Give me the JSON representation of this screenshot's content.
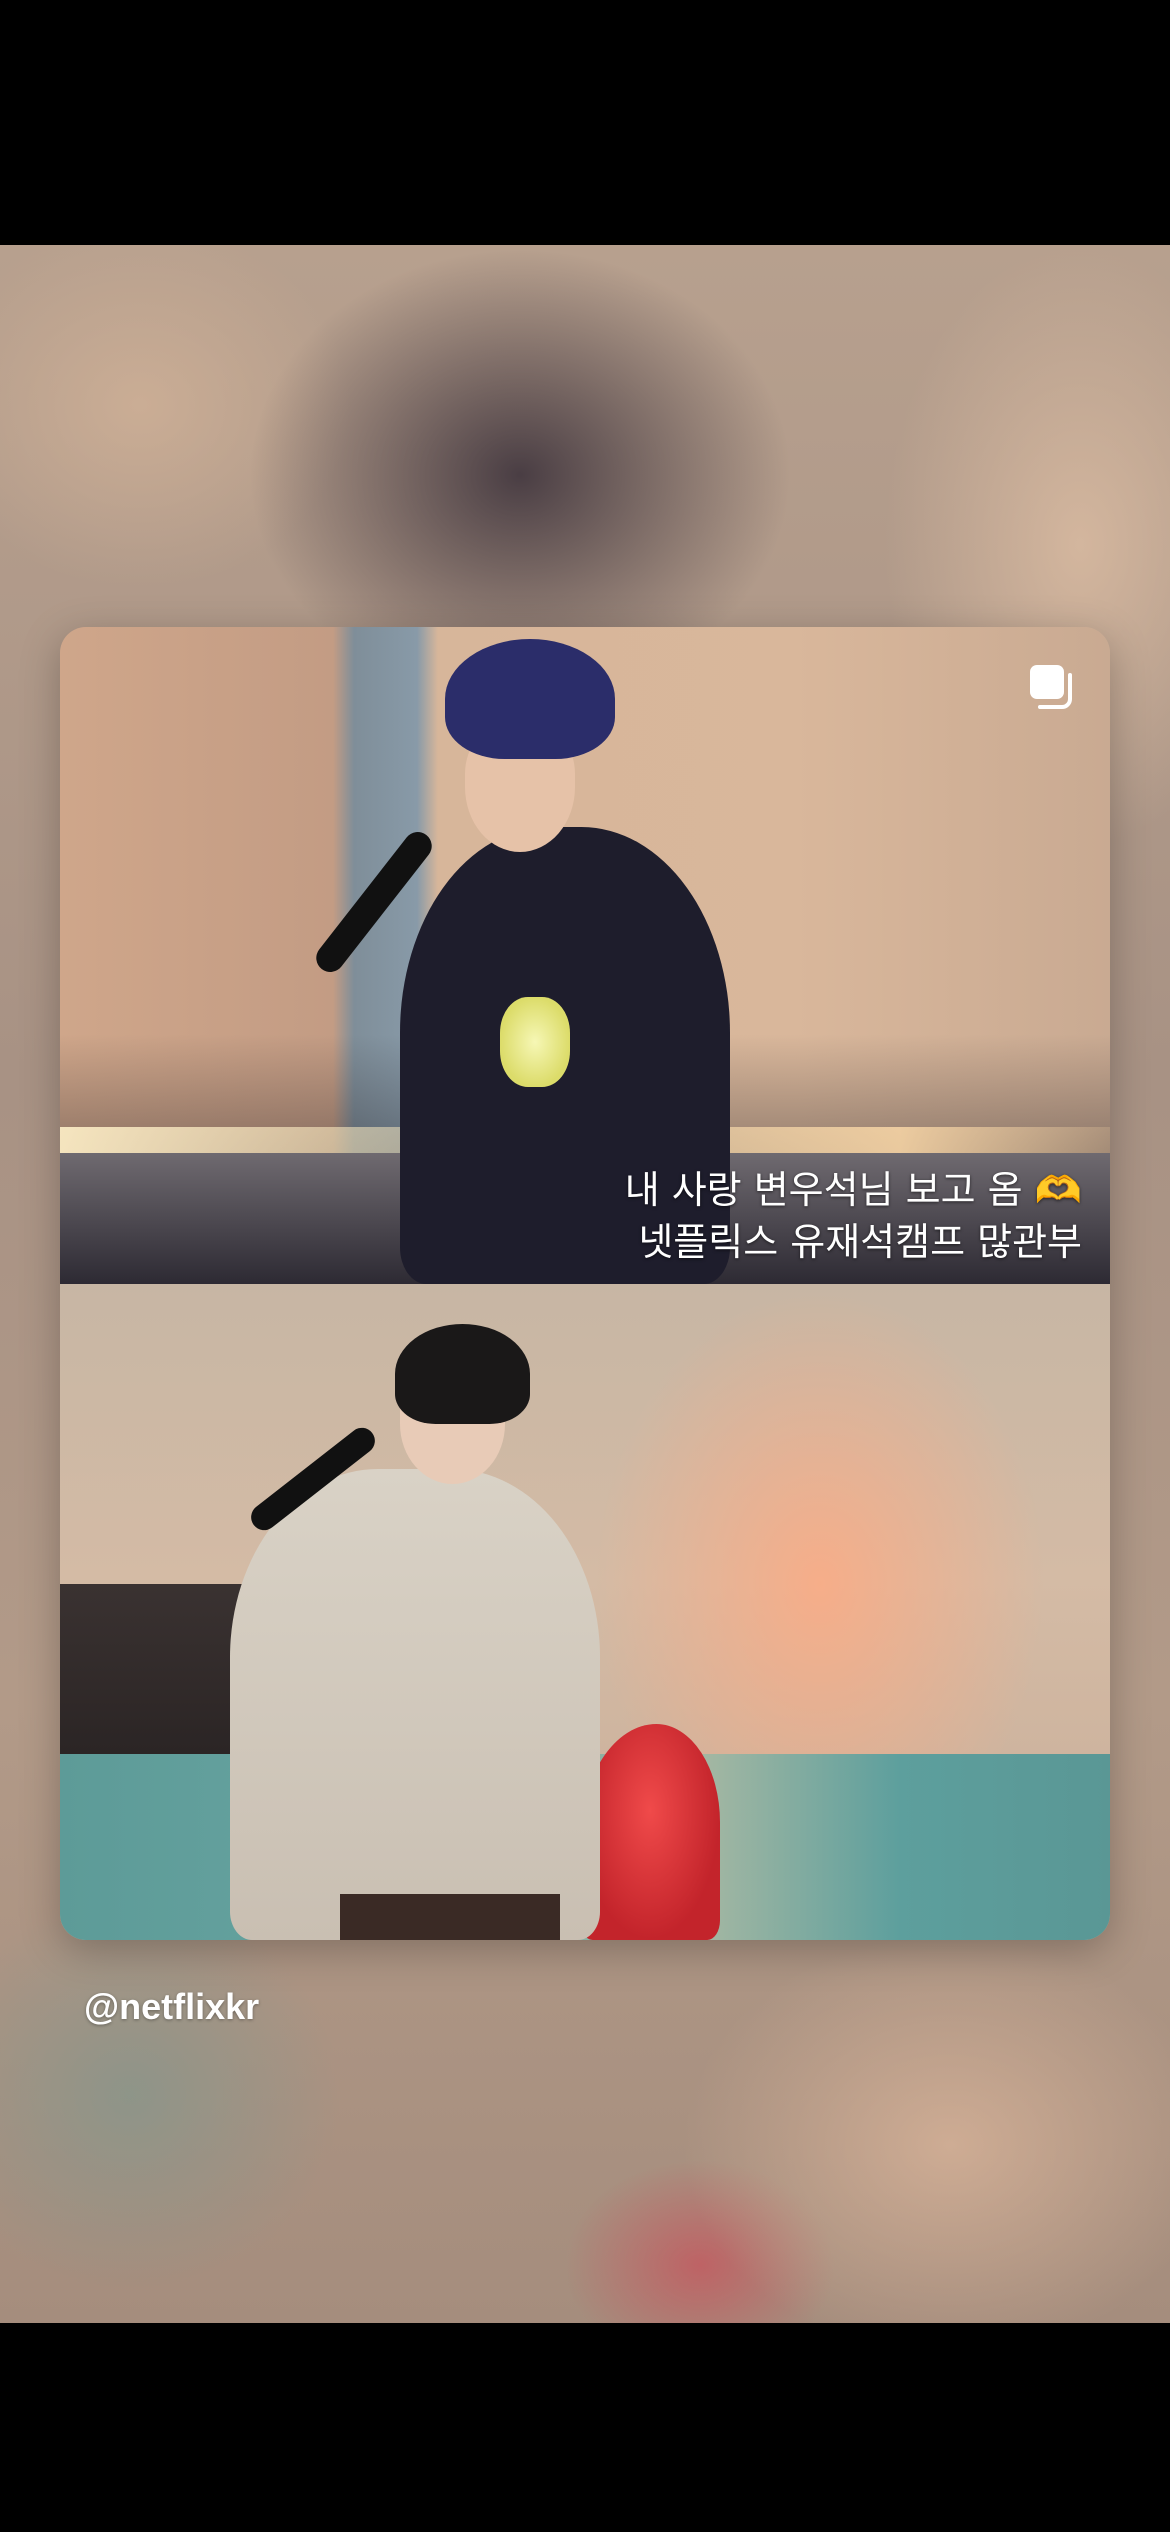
{
  "story": {
    "caption_lines": [
      "내 사랑 변우석님 보고 옴 🫶",
      "넷플릭스 유재석캠프 많관부"
    ],
    "mention": "@netflixkr",
    "multi_photo_icon": "multi-photo-icon",
    "accent_colors": {
      "text": "#ffffff",
      "background": "#000000"
    }
  }
}
